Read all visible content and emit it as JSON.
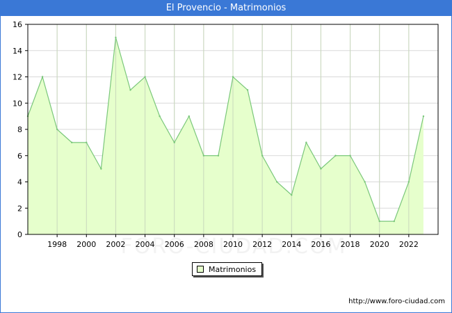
{
  "title": "El Provencio - Matrimonios",
  "source": "http://www.foro-ciudad.com",
  "watermark": "FORO-CIUDAD.COM",
  "colors": {
    "title_bar": "#3a78d6",
    "area_fill": "#e6ffcc",
    "line": "#7ac77a",
    "grid": "#d9d9d9"
  },
  "chart_data": {
    "type": "area",
    "title": "El Provencio - Matrimonios",
    "xlabel": "",
    "ylabel": "",
    "xlim": [
      1996,
      2024
    ],
    "ylim": [
      0,
      16
    ],
    "x_ticks": [
      1998,
      2000,
      2002,
      2004,
      2006,
      2008,
      2010,
      2012,
      2014,
      2016,
      2018,
      2020,
      2022
    ],
    "y_ticks": [
      0,
      2,
      4,
      6,
      8,
      10,
      12,
      14,
      16
    ],
    "grid": true,
    "legend_position": "bottom-center",
    "series": [
      {
        "name": "Matrimonios",
        "x": [
          1996,
          1997,
          1998,
          1999,
          2000,
          2001,
          2002,
          2003,
          2004,
          2005,
          2006,
          2007,
          2008,
          2009,
          2010,
          2011,
          2012,
          2013,
          2014,
          2015,
          2016,
          2017,
          2018,
          2019,
          2020,
          2021,
          2022,
          2023
        ],
        "values": [
          9,
          12,
          8,
          7,
          7,
          5,
          15,
          11,
          12,
          9,
          7,
          9,
          6,
          6,
          12,
          11,
          6,
          4,
          3,
          7,
          5,
          6,
          6,
          4,
          1,
          1,
          4,
          9
        ]
      }
    ]
  }
}
